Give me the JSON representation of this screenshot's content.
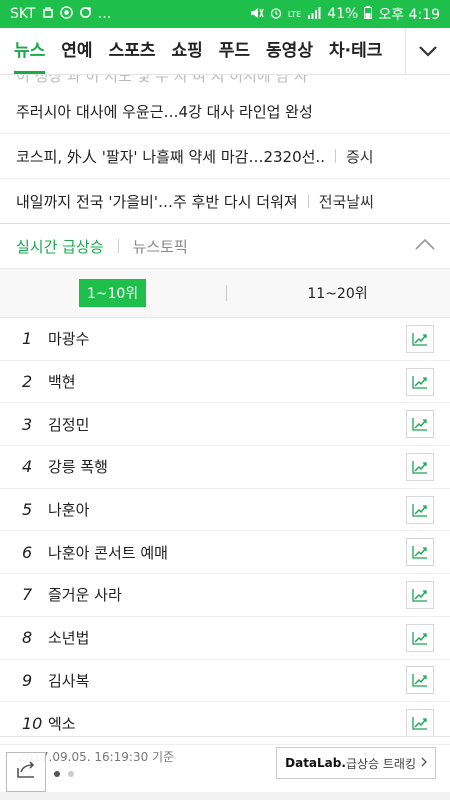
{
  "status_bar": {
    "carrier": "SKT",
    "network": "LTE",
    "battery": "41%",
    "time": "오후 4:19",
    "bg_color": "#1fbf4c"
  },
  "nav": {
    "tabs": [
      "뉴스",
      "연예",
      "스포츠",
      "쇼핑",
      "푸드",
      "동영상",
      "차·테크"
    ],
    "active_index": 0,
    "accent_color": "#1aa84f"
  },
  "ghost_text": "이 정상 과 이 지도 및 무 지 혀 지 이시에 남 사",
  "news": [
    {
      "headline": "주러시아 대사에 우윤근…4강 대사 라인업 완성",
      "category": ""
    },
    {
      "headline": "코스피, 外人 '팔자' 나흘째 약세 마감…2320선..",
      "category": "증시"
    },
    {
      "headline": "내일까지 전국 '가을비'…주 후반 다시 더워져",
      "category": "전국날씨"
    }
  ],
  "realtime": {
    "tab_active": "실시간 급상승",
    "tab_inactive": "뉴스토픽",
    "range_tabs": [
      "1~10위",
      "11~20위"
    ],
    "ranks": [
      {
        "num": "1",
        "keyword": "마광수"
      },
      {
        "num": "2",
        "keyword": "백현"
      },
      {
        "num": "3",
        "keyword": "김정민"
      },
      {
        "num": "4",
        "keyword": "강릉 폭행"
      },
      {
        "num": "5",
        "keyword": "나훈아"
      },
      {
        "num": "6",
        "keyword": "나훈아 콘서트 예매"
      },
      {
        "num": "7",
        "keyword": "즐거운 사라"
      },
      {
        "num": "8",
        "keyword": "소년법"
      },
      {
        "num": "9",
        "keyword": "김사복"
      },
      {
        "num": "10",
        "keyword": "엑소"
      }
    ],
    "timestamp": "2017.09.05. 16:19:30 기준",
    "datalab_label": "DataLab.",
    "datalab_sub": "급상승 트래킹"
  }
}
